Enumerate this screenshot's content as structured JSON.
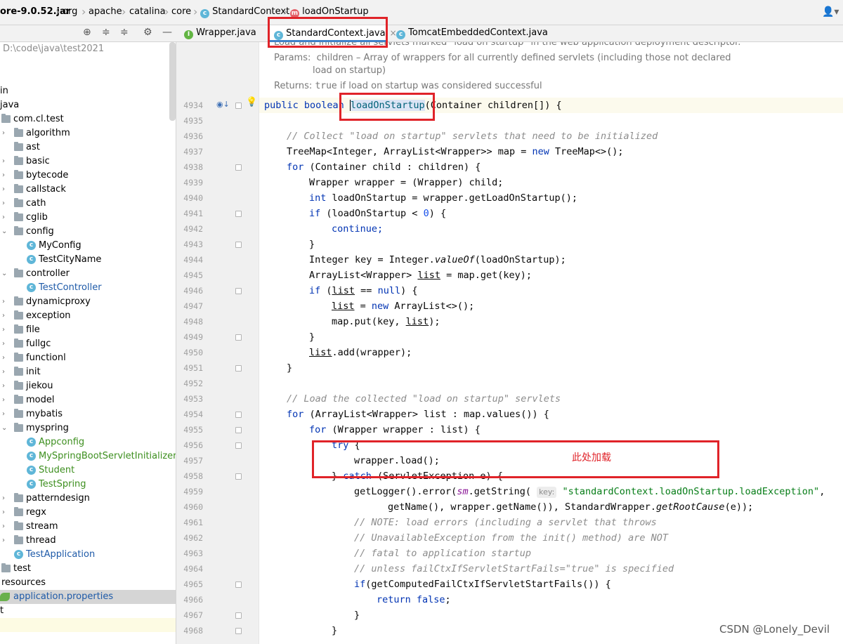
{
  "breadcrumb": {
    "items": [
      "ore-9.0.52.jar",
      "org",
      "apache",
      "catalina",
      "core",
      "StandardContext",
      "loadOnStartup"
    ]
  },
  "project": {
    "path": "D:\\code\\java\\test2021",
    "items": [
      "in",
      "java",
      "com.cl.test",
      "algorithm",
      "ast",
      "basic",
      "bytecode",
      "callstack",
      "cath",
      "cglib",
      "config",
      "MyConfig",
      "TestCityName",
      "controller",
      "TestController",
      "dynamicproxy",
      "exception",
      "file",
      "fullgc",
      "functionl",
      "init",
      "jiekou",
      "model",
      "mybatis",
      "myspring",
      "Appconfig",
      "MySpringBootServletInitializer",
      "Student",
      "TestSpring",
      "patterndesign",
      "regx",
      "stream",
      "thread",
      "TestApplication",
      "test",
      "resources",
      "application.properties",
      "t"
    ]
  },
  "tabs": [
    {
      "label": "Wrapper.java",
      "icon": "interface-icon"
    },
    {
      "label": "StandardContext.java",
      "icon": "class-icon",
      "close": "×"
    },
    {
      "label": "TomcatEmbeddedContext.java",
      "icon": "class-icon"
    }
  ],
  "javadoc": {
    "line1": "Load and initialize all servlets marked \"load on startup\" in the web application deployment descriptor.",
    "params_label": "Params:",
    "params_text": "children – Array of wrappers for all currently defined servlets (including those not declared",
    "params_text2": "load on startup)",
    "returns_label": "Returns:",
    "returns_code": "true",
    "returns_text": "if load on startup was considered successful"
  },
  "line_numbers": [
    "4934",
    "4935",
    "4936",
    "4937",
    "4938",
    "4939",
    "4940",
    "4941",
    "4942",
    "4943",
    "4944",
    "4945",
    "4946",
    "4947",
    "4948",
    "4949",
    "4950",
    "4951",
    "4952",
    "4953",
    "4954",
    "4955",
    "4956",
    "4957",
    "4958",
    "4959",
    "4960",
    "4961",
    "4962",
    "4963",
    "4964",
    "4965",
    "4966",
    "4967",
    "4968"
  ],
  "code": {
    "c4934_a": "public boolean ",
    "c4934_b": "loadOnStartup",
    "c4934_c": "(Container children[]) {",
    "c4936": "// Collect \"load on startup\" servlets that need to be initialized",
    "c4937_a": "TreeMap<Integer, ArrayList<Wrapper>> map = ",
    "c4937_b": "new",
    "c4937_c": " TreeMap<>();",
    "c4938_a": "for",
    "c4938_b": " (Container child : children) {",
    "c4939": "Wrapper wrapper = (Wrapper) child;",
    "c4940_a": "int",
    "c4940_b": " loadOnStartup = wrapper.getLoadOnStartup();",
    "c4941_a": "if",
    "c4941_b": " (loadOnStartup < ",
    "c4941_c": "0",
    "c4941_d": ") {",
    "c4942": "continue;",
    "c4943": "}",
    "c4944_a": "Integer key = Integer.",
    "c4944_b": "valueOf",
    "c4944_c": "(loadOnStartup);",
    "c4945_a": "ArrayList<Wrapper> ",
    "c4945_b": "list",
    "c4945_c": " = map.get(key);",
    "c4946_a": "if",
    "c4946_b": " (",
    "c4946_c": "list",
    "c4946_d": " == ",
    "c4946_e": "null",
    "c4946_f": ") {",
    "c4947_a": "list",
    "c4947_b": " = ",
    "c4947_c": "new",
    "c4947_d": " ArrayList<>();",
    "c4948_a": "map.put(key, ",
    "c4948_b": "list",
    "c4948_c": ");",
    "c4949": "}",
    "c4950_a": "list",
    "c4950_b": ".add(wrapper);",
    "c4951": "}",
    "c4953": "// Load the collected \"load on startup\" servlets",
    "c4954_a": "for",
    "c4954_b": " (ArrayList<Wrapper> list : map.values()) {",
    "c4955_a": "for",
    "c4955_b": " (Wrapper wrapper : list) {",
    "c4956_a": "try",
    "c4956_b": " {",
    "c4957": "wrapper.load();",
    "c4958_a": "} ",
    "c4958_b": "catch",
    "c4958_c": " (ServletException e) {",
    "c4959_a": "getLogger().error(",
    "c4959_b": "sm",
    "c4959_c": ".getString(",
    "c4959_hint": "key:",
    "c4959_d": "\"standardContext.loadOnStartup.loadException\"",
    "c4959_e": ",",
    "c4960_a": "getName(), wrapper.getName()), StandardWrapper.",
    "c4960_b": "getRootCause",
    "c4960_c": "(e));",
    "c4961": "// NOTE: load errors (including a servlet that throws",
    "c4962": "// UnavailableException from the init() method) are NOT",
    "c4963": "// fatal to application startup",
    "c4964": "// unless failCtxIfServletStartFails=\"true\" is specified",
    "c4965_a": "if",
    "c4965_b": "(getComputedFailCtxIfServletStartFails()) {",
    "c4966_a": "return false",
    "c4966_b": ";",
    "c4967": "}",
    "c4968": "}"
  },
  "annotation": "此处加载",
  "watermark": "CSDN @Lonely_Devil",
  "colors": {
    "annotation_red": "#e02329",
    "keyword": "#0033b3",
    "string": "#067d17",
    "comment": "#8c8c8c"
  }
}
